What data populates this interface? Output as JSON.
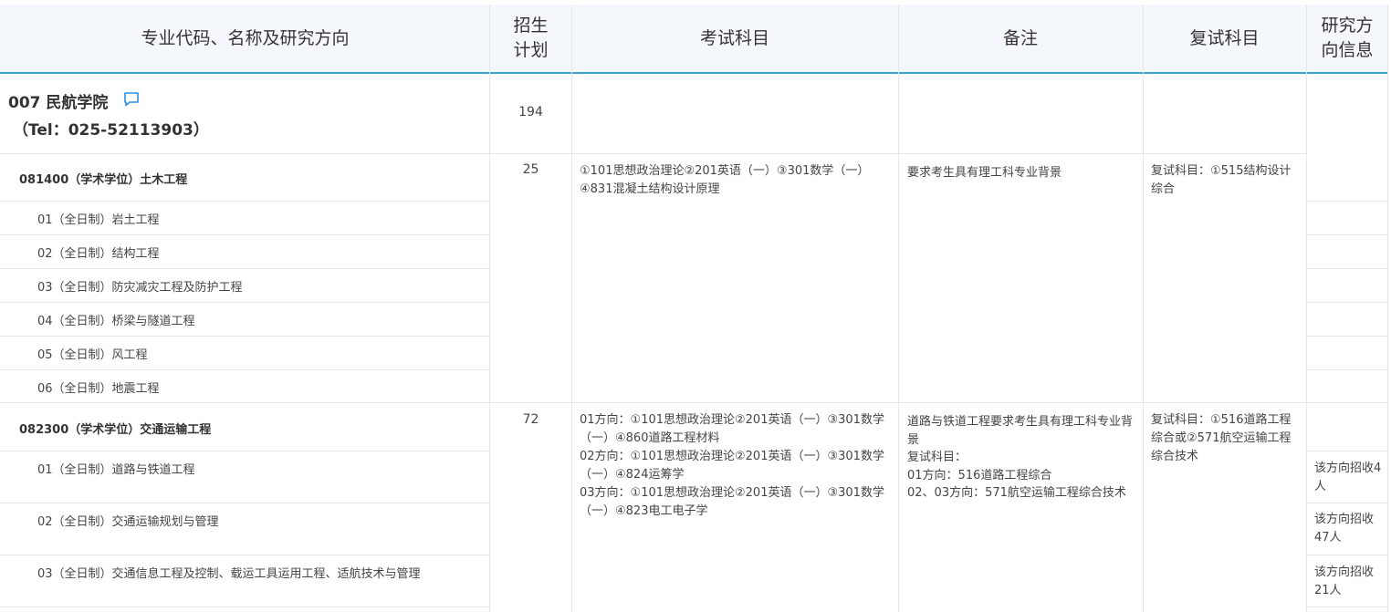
{
  "header": {
    "col_major": "专业代码、名称及研究方向",
    "col_plan_line1": "招生",
    "col_plan_line2": "计划",
    "col_exam": "考试科目",
    "col_notes": "备注",
    "col_retest": "复试科目",
    "col_research_line1": "研究方",
    "col_research_line2": "向信息"
  },
  "department": {
    "name": "007 民航学院",
    "tel": "（Tel：025-52113903）",
    "plan": "194",
    "chat_icon": "comment-icon"
  },
  "majors": [
    {
      "title": "081400（学术学位）土木工程",
      "plan": "25",
      "exam": "①101思想政治理论②201英语（一）③301数学（一）④831混凝土结构设计原理",
      "notes": "要求考生具有理工科专业背景",
      "retest": "复试科目：①515结构设计综合",
      "directions": [
        "01（全日制）岩土工程",
        "02（全日制）结构工程",
        "03（全日制）防灾减灾工程及防护工程",
        "04（全日制）桥梁与隧道工程",
        "05（全日制）风工程",
        "06（全日制）地震工程"
      ]
    },
    {
      "title": "082300（学术学位）交通运输工程",
      "plan": "72",
      "exam_lines": [
        "01方向：①101思想政治理论②201英语（一）③301数学（一）④860道路工程材料",
        "02方向：①101思想政治理论②201英语（一）③301数学（一）④824运筹学",
        "03方向：①101思想政治理论②201英语（一）③301数学（一）④823电工电子学"
      ],
      "notes_lines": [
        "道路与铁道工程要求考生具有理工科专业背景",
        "复试科目：",
        "01方向：516道路工程综合",
        "02、03方向：571航空运输工程综合技术"
      ],
      "retest": "复试科目：①516道路工程综合或②571航空运输工程综合技术",
      "directions": [
        "01（全日制）道路与铁道工程",
        "02（全日制）交通运输规划与管理",
        "03（全日制）交通信息工程及控制、载运工具运用工程、适航技术与管理"
      ],
      "direction_quotas": [
        "该方向招收4人",
        "该方向招收47人",
        "该方向招收21人"
      ]
    }
  ]
}
